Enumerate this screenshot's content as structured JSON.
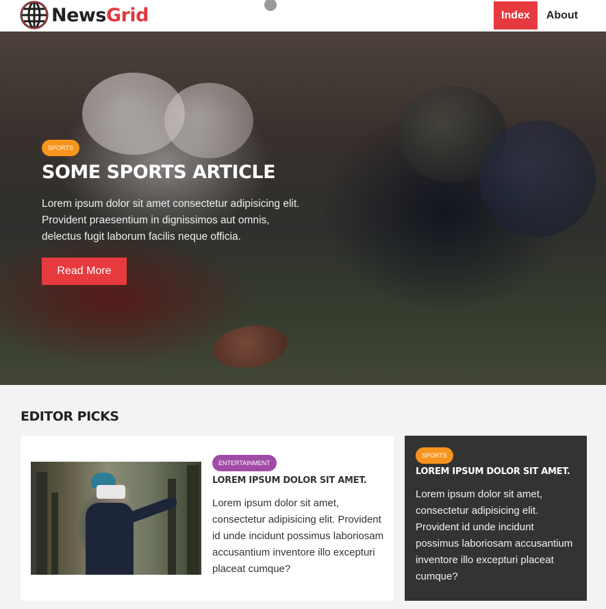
{
  "header": {
    "logo_word1": "News",
    "logo_word2": "Grid",
    "nav": [
      {
        "label": "Index",
        "active": true
      },
      {
        "label": "About",
        "active": false
      }
    ]
  },
  "hero": {
    "category": "SPORTS",
    "title": "Some Sports Article",
    "text": "Lorem ipsum dolor sit amet consectetur adipisicing elit. Provident praesentium in dignissimos aut omnis, delectus fugit laborum facilis neque officia.",
    "button": "Read More"
  },
  "editor_picks": {
    "heading": "Editor Picks",
    "main_card": {
      "category": "ENTERTAINMENT",
      "title": "Lorem ipsum dolor sit amet.",
      "text": "Lorem ipsum dolor sit amet, consectetur adipisicing elit. Provident id unde incidunt possimus laboriosam accusantium inventore illo excepturi placeat cumque?"
    },
    "side_card": {
      "category": "SPORTS",
      "title": "Lorem ipsum dolor sit amet.",
      "text": "Lorem ipsum dolor sit amet, consectetur adipisicing elit. Provident id unde incidunt possimus laboriosam accusantium inventore illo excepturi placeat cumque?"
    }
  },
  "colors": {
    "accent": "#e63a3f",
    "sports_badge": "#f7941d",
    "entertainment_badge": "#a04ba6",
    "dark_card": "#333333"
  },
  "icons": {
    "logo": "globe-icon"
  }
}
